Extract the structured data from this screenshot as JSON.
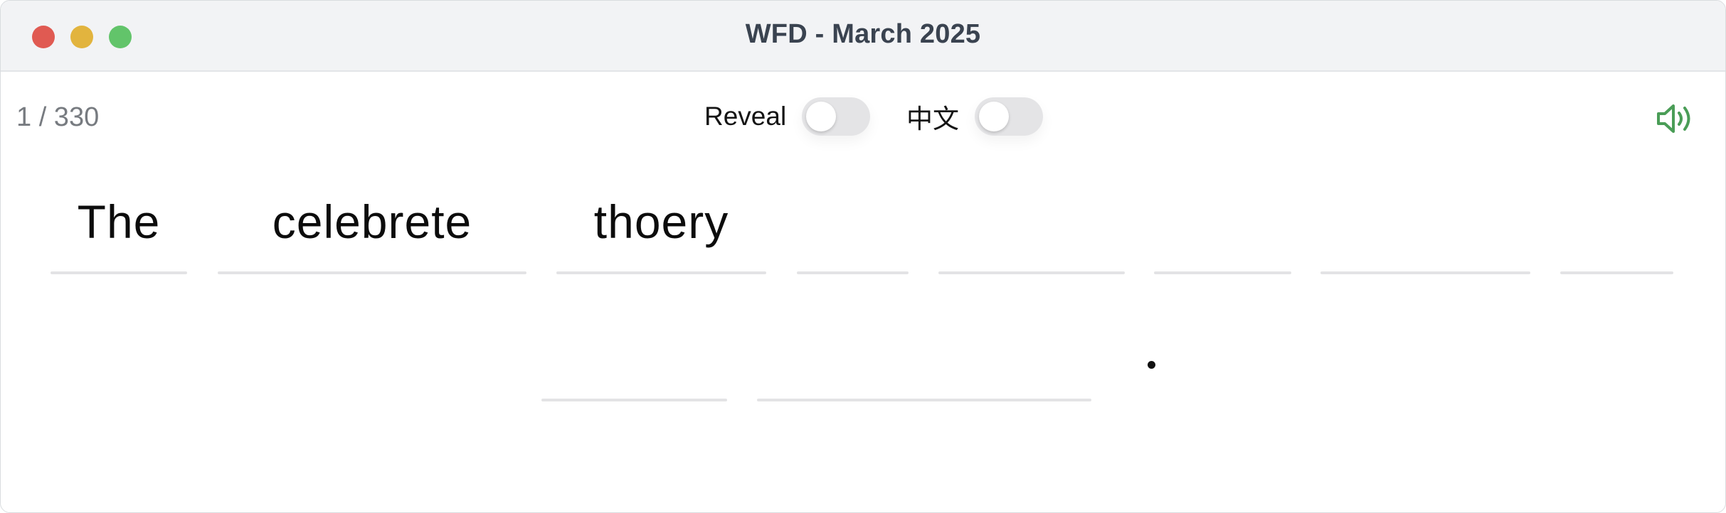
{
  "window": {
    "title": "WFD - March 2025"
  },
  "toolbar": {
    "counter": "1 / 330",
    "reveal_label": "Reveal",
    "reveal_on": false,
    "chinese_label": "中文",
    "chinese_on": false,
    "audio_icon": "speaker-icon",
    "accent_color": "#4a9d57"
  },
  "sentence": {
    "words": [
      "The",
      "celebrete",
      "thoery",
      "",
      "",
      "",
      "",
      "",
      "",
      ""
    ],
    "end_punctuation": "."
  }
}
